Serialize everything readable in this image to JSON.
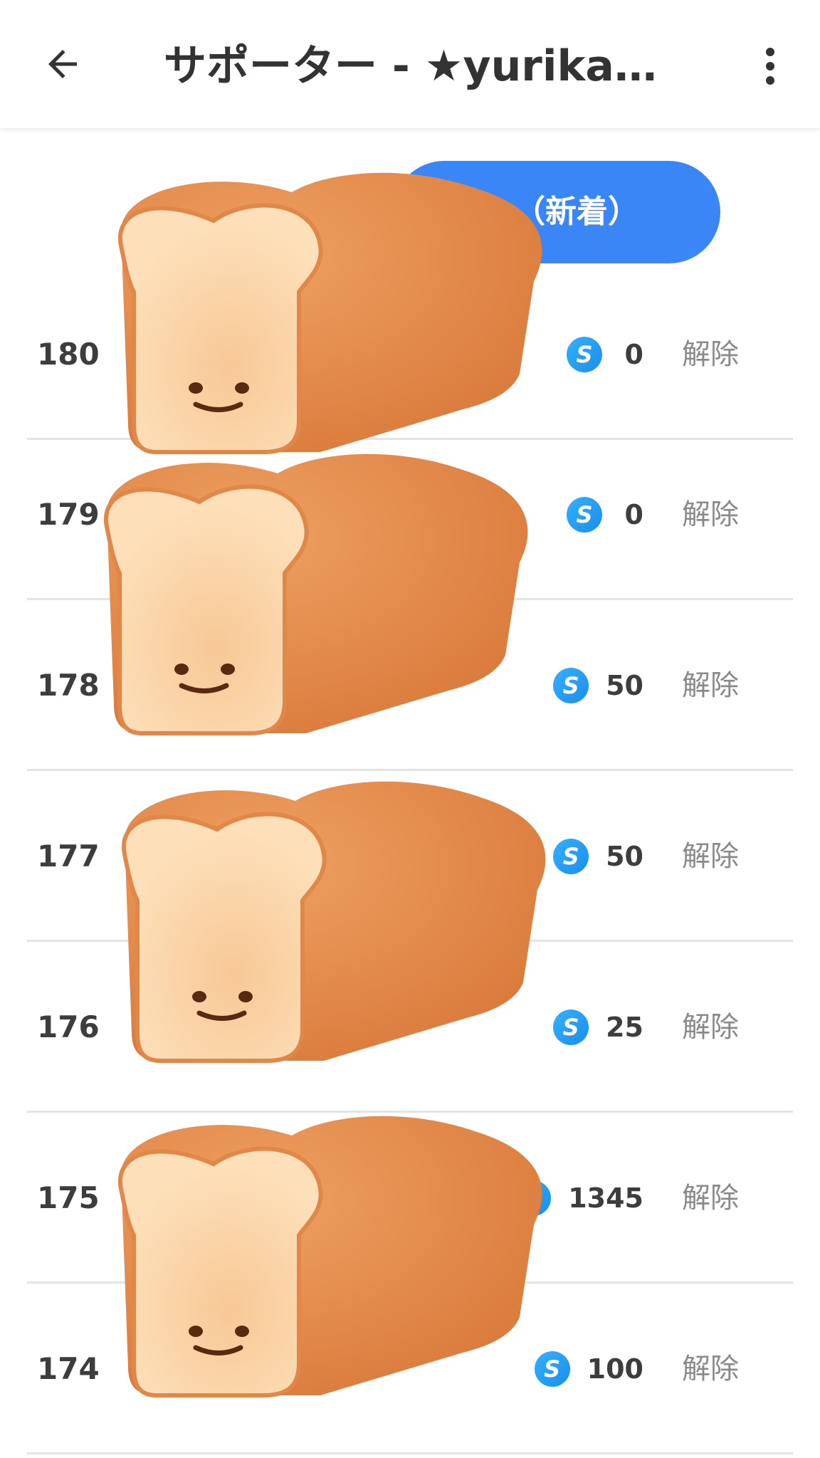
{
  "header": {
    "title": "サポーター - ★yurika★…",
    "back_icon": "arrow-left-icon",
    "more_icon": "more-vert-icon"
  },
  "sort": {
    "label": "（新着）"
  },
  "colors": {
    "accent": "#3b86f7",
    "coin": "#1a8ee8",
    "bread_crust": "#e0874a",
    "bread_face": "#fbd8ae"
  },
  "supporters": [
    {
      "rank": "180",
      "amount": "0",
      "action": "解除"
    },
    {
      "rank": "179",
      "amount": "0",
      "action": "解除"
    },
    {
      "rank": "178",
      "amount": "50",
      "action": "解除"
    },
    {
      "rank": "177",
      "amount": "50",
      "action": "解除"
    },
    {
      "rank": "176",
      "amount": "25",
      "action": "解除"
    },
    {
      "rank": "175",
      "amount": "1345",
      "action": "解除"
    },
    {
      "rank": "174",
      "amount": "100",
      "action": "解除"
    }
  ],
  "coin_symbol": "S"
}
